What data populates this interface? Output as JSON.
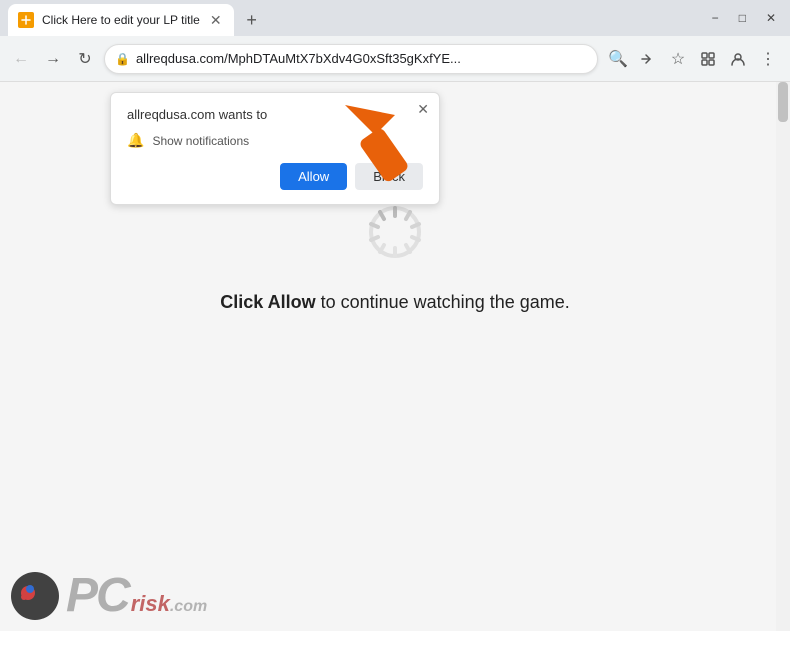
{
  "browser": {
    "title_bar": {
      "minimize": "−",
      "maximize": "□",
      "close": "✕"
    },
    "tab": {
      "favicon_text": "🔒",
      "title": "Click Here to edit your LP title",
      "close": "✕"
    },
    "new_tab_label": "+",
    "omnibar": {
      "back": "←",
      "forward": "→",
      "reload": "↻",
      "url": "allreqdusa.com/MphDTAuMtX7bXdv4G0xSft35gKxfYE...",
      "search_icon": "🔍",
      "share_icon": "↗",
      "bookmark_icon": "☆",
      "extension_icon": "⊡",
      "profile_icon": "👤",
      "menu_icon": "⋮"
    }
  },
  "popup": {
    "header": "allreqdusa.com wants to",
    "bell_text": "Show notifications",
    "close": "✕",
    "allow_btn": "Allow",
    "block_btn": "Block"
  },
  "page": {
    "main_text_bold": "Click Allow",
    "main_text_rest": " to continue watching the game."
  },
  "watermark": {
    "brand": "PC",
    "suffix": "risk.com"
  },
  "colors": {
    "arrow": "#e8610a",
    "allow_btn": "#1a73e8",
    "spinner": "#c8c8c8"
  }
}
